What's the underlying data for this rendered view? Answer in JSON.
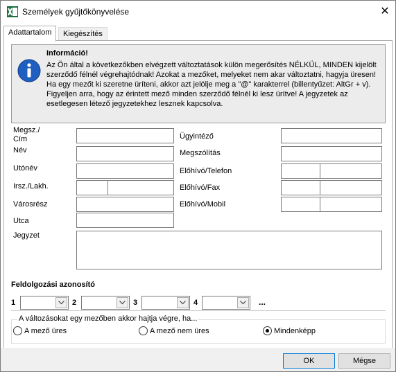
{
  "window": {
    "title": "Személyek gyűjtőkönyvelése",
    "close_glyph": "✕"
  },
  "tabs": [
    {
      "label": "Adattartalom",
      "active": true
    },
    {
      "label": "Kiegészítés",
      "active": false
    }
  ],
  "info": {
    "title": "Információ!",
    "lines": [
      "Az Ön által a következőkben elvégzett változtatások külön megerősítés NÉLKÜL, MINDEN kijelölt",
      "szerződő félnél végrehajtódnak! Azokat a mezőket, melyeket nem akar változtatni, hagyja üresen!",
      "Ha egy mezőt ki szeretne üríteni, akkor azt jelölje meg a \"@\" karakterrel (billentyűzet: AltGr + v).",
      "Figyeljen arra, hogy az érintett mező minden szerződő félnél ki lesz ürítve! A jegyzetek az",
      "esetlegesen létező jegyzetekhez lesznek kapcsolva."
    ]
  },
  "fields_left": {
    "megsz_line1": "Megsz./",
    "megsz_line2": "Cím",
    "nev": "Név",
    "utonev": "Utónév",
    "irsz": "Irsz./Lakh.",
    "varosresz": "Városrész",
    "utca": "Utca",
    "jegyzet": "Jegyzet"
  },
  "fields_right": {
    "ugyintezo": "Ügyintéző",
    "megszolitas": "Megszólítás",
    "telefon": "Előhívó/Telefon",
    "fax": "Előhívó/Fax",
    "mobil": "Előhívó/Mobil"
  },
  "processing": {
    "title": "Feldolgozási azonosító",
    "numbers": [
      "1",
      "2",
      "3",
      "4"
    ],
    "ellipsis": "..."
  },
  "mode_group": {
    "legend": "A változásokat egy mezőben akkor hajtja végre, ha...",
    "options": [
      {
        "label": "A mező üres",
        "checked": false
      },
      {
        "label": "A mező nem üres",
        "checked": false
      },
      {
        "label": "Mindenképp",
        "checked": true
      }
    ]
  },
  "buttons": {
    "ok": "OK",
    "cancel": "Mégse"
  },
  "colors": {
    "accent": "#0078d7",
    "info_bg": "#ececec",
    "icon_blue": "#1f5fbf",
    "excel_green": "#1d6f42"
  }
}
